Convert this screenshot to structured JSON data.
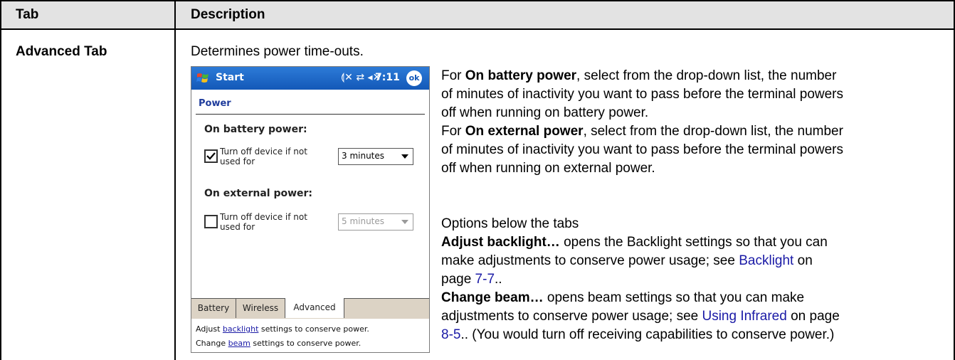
{
  "table": {
    "col_tab_header": "Tab",
    "col_desc_header": "Description",
    "row_tab_name": "Advanced Tab",
    "row_intro": "Determines power time-outs."
  },
  "explanation": {
    "p1_prefix": "For ",
    "p1_bold": "On battery power",
    "p1_line1_rest": ", select from the drop-down list, the number",
    "p1_line2": "of minutes of inactivity you want to pass before the terminal powers",
    "p1_line3": "off when running on battery power.",
    "p2_prefix": "For ",
    "p2_bold": "On external power",
    "p2_line1_rest": ", select from the drop-down list, the number",
    "p2_line2": "of minutes of inactivity you want to pass before the terminal powers",
    "p2_line3": "off when running on external power.",
    "options_heading": "Options below the tabs",
    "adj_bold": "Adjust backlight…",
    "adj_line1_rest": " opens the Backlight settings so that you can",
    "adj_line2": "make adjustments to conserve power usage; see ",
    "adj_link": "Backlight",
    "adj_line2_end": " on",
    "adj_line3_prefix": "page ",
    "adj_page_link": "7-7",
    "adj_line3_end": "..",
    "beam_bold": "Change beam…",
    "beam_line1_rest": " opens beam settings so that you can make",
    "beam_line2": "adjustments to conserve power usage; see ",
    "beam_link": "Using Infrared",
    "beam_line2_end": " on page",
    "beam_page_link": "8-5",
    "beam_line3_end": ".. (You would turn off receiving capabilities to conserve power.)"
  },
  "device": {
    "title": "Start",
    "status_icons": "⟬✕ ⇄ ◂✕",
    "time": "7:11",
    "ok_label": "ok",
    "heading": "Power",
    "battery_section": "On battery power:",
    "battery_check_line1": "Turn off device if not",
    "battery_check_line2": "used for",
    "battery_checked": true,
    "battery_select": "3 minutes",
    "external_section": "On external power:",
    "external_check_line1": "Turn off device if not",
    "external_check_line2": "used for",
    "external_checked": false,
    "external_select": "5 minutes",
    "tabs": [
      "Battery",
      "Wireless",
      "Advanced"
    ],
    "footer1_prefix": "Adjust ",
    "footer1_link": "backlight",
    "footer1_suffix": " settings to conserve power.",
    "footer2_prefix": "Change ",
    "footer2_link": "beam",
    "footer2_suffix": " settings to conserve power."
  }
}
